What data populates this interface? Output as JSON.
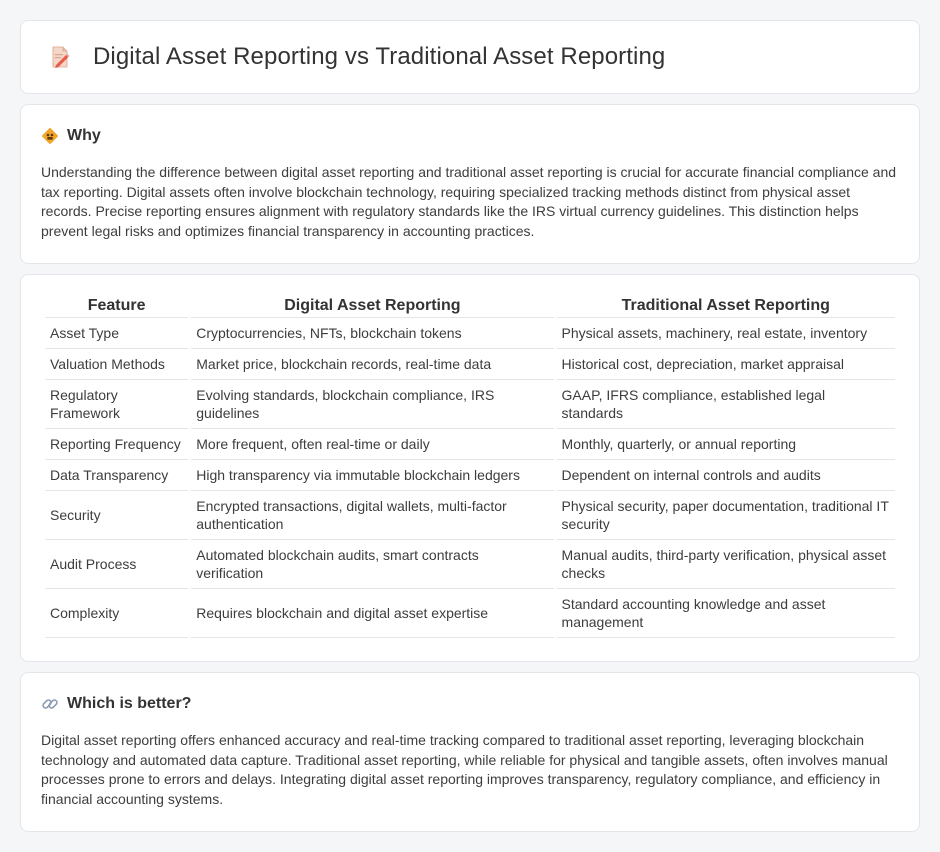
{
  "header": {
    "title": "Digital Asset Reporting vs Traditional Asset Reporting",
    "icon": "document-pencil-icon"
  },
  "why": {
    "heading": "Why",
    "icon": "warning-sign-icon",
    "text": "Understanding the difference between digital asset reporting and traditional asset reporting is crucial for accurate financial compliance and tax reporting. Digital assets often involve blockchain technology, requiring specialized tracking methods distinct from physical asset records. Precise reporting ensures alignment with regulatory standards like the IRS virtual currency guidelines. This distinction helps prevent legal risks and optimizes financial transparency in accounting practices."
  },
  "table": {
    "headers": [
      "Feature",
      "Digital Asset Reporting",
      "Traditional Asset Reporting"
    ],
    "rows": [
      [
        "Asset Type",
        "Cryptocurrencies, NFTs, blockchain tokens",
        "Physical assets, machinery, real estate, inventory"
      ],
      [
        "Valuation Methods",
        "Market price, blockchain records, real-time data",
        "Historical cost, depreciation, market appraisal"
      ],
      [
        "Regulatory Framework",
        "Evolving standards, blockchain compliance, IRS guidelines",
        "GAAP, IFRS compliance, established legal standards"
      ],
      [
        "Reporting Frequency",
        "More frequent, often real-time or daily",
        "Monthly, quarterly, or annual reporting"
      ],
      [
        "Data Transparency",
        "High transparency via immutable blockchain ledgers",
        "Dependent on internal controls and audits"
      ],
      [
        "Security",
        "Encrypted transactions, digital wallets, multi-factor authentication",
        "Physical security, paper documentation, traditional IT security"
      ],
      [
        "Audit Process",
        "Automated blockchain audits, smart contracts verification",
        "Manual audits, third-party verification, physical asset checks"
      ],
      [
        "Complexity",
        "Requires blockchain and digital asset expertise",
        "Standard accounting knowledge and asset management"
      ]
    ]
  },
  "better": {
    "heading": "Which is better?",
    "icon": "link-icon",
    "text": "Digital asset reporting offers enhanced accuracy and real-time tracking compared to traditional asset reporting, leveraging blockchain technology and automated data capture. Traditional asset reporting, while reliable for physical and tangible assets, often involves manual processes prone to errors and delays. Integrating digital asset reporting improves transparency, regulatory compliance, and efficiency in financial accounting systems."
  }
}
